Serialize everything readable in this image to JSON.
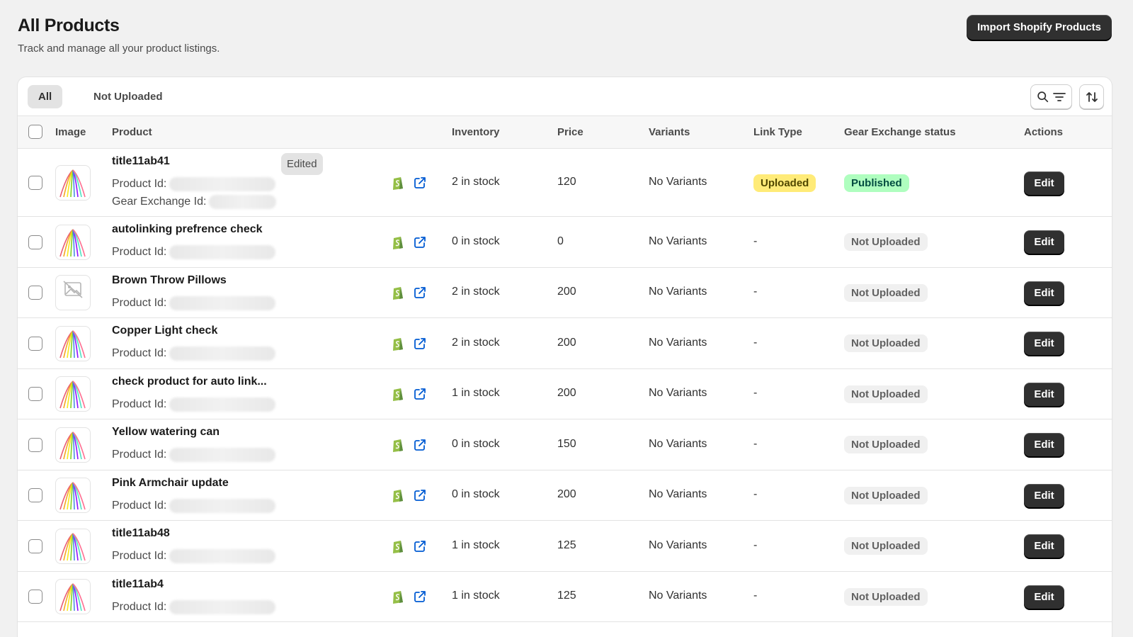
{
  "header": {
    "title": "All Products",
    "subtitle": "Track and manage all your product listings.",
    "import_button": "Import Shopify Products"
  },
  "tabs": [
    {
      "label": "All",
      "active": true
    },
    {
      "label": "Not Uploaded",
      "active": false
    }
  ],
  "toolbar": {
    "search_icon": "search-icon",
    "filter_icon": "filter-icon",
    "sort_icon": "sort-icon"
  },
  "columns": {
    "image": "Image",
    "product": "Product",
    "inventory": "Inventory",
    "price": "Price",
    "variants": "Variants",
    "link_type": "Link Type",
    "status": "Gear Exchange status",
    "actions": "Actions"
  },
  "labels": {
    "product_id": "Product Id:",
    "gear_exchange_id": "Gear Exchange Id:",
    "edit": "Edit",
    "edited": "Edited",
    "no_image": "No image"
  },
  "colors": {
    "primary_button": "#303030",
    "uploaded_badge": "#ffeb78",
    "published_badge": "#affebf",
    "not_uploaded_badge": "#f0f0f0",
    "link_icon": "#005bd3",
    "shopify_icon": "#95bf47"
  },
  "rows": [
    {
      "name": "title11ab41",
      "edited": true,
      "gear_id": true,
      "image": "striped",
      "inventory": "2 in stock",
      "price": "120",
      "variants": "No Variants",
      "link_type": "Uploaded",
      "status": "Published"
    },
    {
      "name": "autolinking prefrence check",
      "image": "striped",
      "inventory": "0 in stock",
      "price": "0",
      "variants": "No Variants",
      "link_type": "-",
      "status": "Not Uploaded"
    },
    {
      "name": "Brown Throw Pillows",
      "image": "none",
      "inventory": "2 in stock",
      "price": "200",
      "variants": "No Variants",
      "link_type": "-",
      "status": "Not Uploaded"
    },
    {
      "name": "Copper Light check",
      "image": "striped",
      "inventory": "2 in stock",
      "price": "200",
      "variants": "No Variants",
      "link_type": "-",
      "status": "Not Uploaded"
    },
    {
      "name": "check product for auto link...",
      "image": "striped",
      "inventory": "1 in stock",
      "price": "200",
      "variants": "No Variants",
      "link_type": "-",
      "status": "Not Uploaded"
    },
    {
      "name": "Yellow watering can",
      "image": "striped",
      "inventory": "0 in stock",
      "price": "150",
      "variants": "No Variants",
      "link_type": "-",
      "status": "Not Uploaded"
    },
    {
      "name": "Pink Armchair update",
      "image": "striped",
      "inventory": "0 in stock",
      "price": "200",
      "variants": "No Variants",
      "link_type": "-",
      "status": "Not Uploaded"
    },
    {
      "name": "title11ab48",
      "image": "striped",
      "inventory": "1 in stock",
      "price": "125",
      "variants": "No Variants",
      "link_type": "-",
      "status": "Not Uploaded"
    },
    {
      "name": "title11ab4",
      "image": "striped",
      "inventory": "1 in stock",
      "price": "125",
      "variants": "No Variants",
      "link_type": "-",
      "status": "Not Uploaded"
    }
  ]
}
